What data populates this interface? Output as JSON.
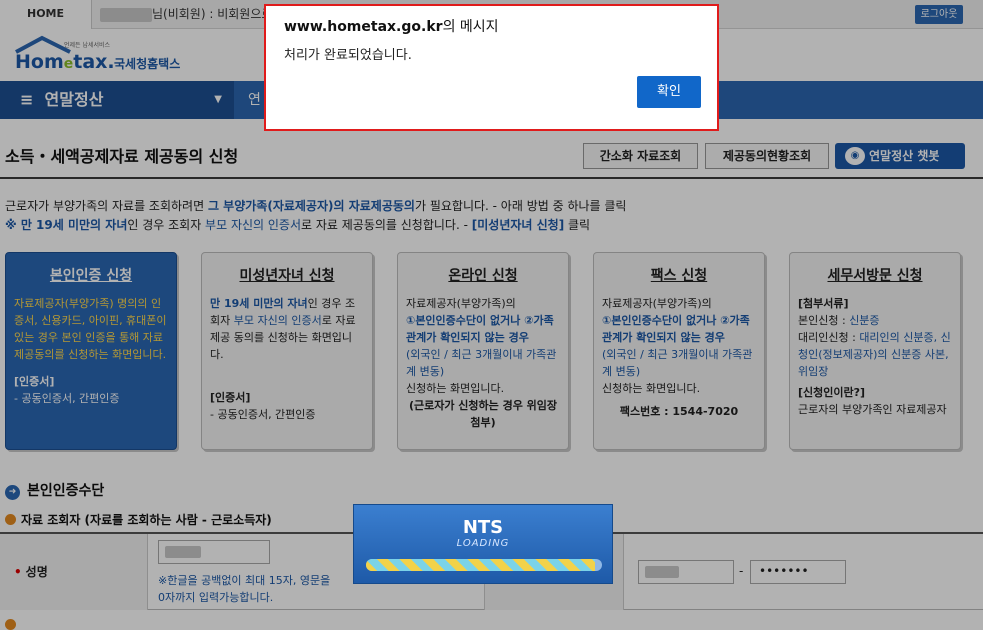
{
  "topbar": {
    "home": "HOME",
    "user_suffix": "님(비회원) : 비회원으로",
    "logout": "로그아웃"
  },
  "logo": {
    "brand": "Hometax",
    "kr": "국세청홈택스",
    "tagline": "언제든 납세서비스"
  },
  "nav": {
    "menu": "연말정산",
    "crumb": "연"
  },
  "page": {
    "title": "소득・세액공제자료 제공동의 신청",
    "btn_simple": "간소화 자료조회",
    "btn_status": "제공동의현황조회",
    "btn_chatbot": "연말정산 챗봇"
  },
  "intro": {
    "l1a": "근로자가 부양가족의 자료를 조회하려면 ",
    "l1b": "그 부양가족(자료제공자)의 자료제공동의",
    "l1c": "가 필요합니다. - 아래 방법 중 하나를 클릭",
    "l2a": "※ 만 19세 미만의 자녀",
    "l2b": "인 경우 조회자 ",
    "l2c": "부모 자신의 인증서",
    "l2d": "로 자료 제공동의를 신청합니다. - ",
    "l2e": "[미성년자녀 신청]",
    "l2f": " 클릭"
  },
  "cards": [
    {
      "title": "본인인증 신청",
      "desc": "자료제공자(부양가족) 명의의 인증서, 신용카드, 아이핀,  휴대폰이 있는 경우 본인 인증을 통해 자료제공동의를 신청하는 화면입니다.",
      "label": "[인증서]",
      "note": "- 공동인증서, 간편인증"
    },
    {
      "title": "미성년자녀 신청",
      "b1": "만 19세 미만의 자녀",
      "t1": "인 경우 조회자 ",
      "b2": "부모 자신의 인증서",
      "t2": "로 자료 제공 동의를 신청하는 화면입니다.",
      "label": "[인증서]",
      "note": "- 공동인증서, 간편인증"
    },
    {
      "title": "온라인 신청",
      "t1": "자료제공자(부양가족)의",
      "b1": "①본인인증수단이 없거나 ②가족관계가 확인되지 않는 경우",
      "t2": "(외국인 / 최근 3개월이내 가족관계 변동)",
      "t3": "신청하는 화면입니다.",
      "c": "(근로자가 신청하는 경우 위임장 첨부)"
    },
    {
      "title": "팩스 신청",
      "t1": "자료제공자(부양가족)의",
      "b1": "①본인인증수단이 없거나 ②가족관계가 확인되지 않는 경우",
      "t2": "(외국인 / 최근 3개월이내 가족관계 변동)",
      "t3": "신청하는 화면입니다.",
      "c": "팩스번호 : 1544-7020"
    },
    {
      "title": "세무서방문 신청",
      "label1": "[첨부서류]",
      "t1": "본인신청 : ",
      "b1": "신분증",
      "t2": "대리인신청 : ",
      "b2": "대리인의 신분증, 신청인(정보제공자)의 신분증 사본, 위임장",
      "label2": "[신청인이란?]",
      "t3": "근로자의 부양가족인 자료제공자"
    }
  ],
  "sections": {
    "auth": "본인인증수단",
    "viewer": "자료 조회자 (자료를 조회하는 사람 - 근로소득자)",
    "name_label": "성명",
    "name_note": "※한글을 공백없이 최대 15자, 영문을",
    "name_note2": "0자까지 입력가능합니다.",
    "pw_mask": "•••••••",
    "dash": "-"
  },
  "loading": {
    "title": "NTS",
    "sub": "LOADING",
    "progress": 0.97
  },
  "dialog": {
    "site": "www.hometax.go.kr",
    "suffix": "의 메시지",
    "message": "처리가 완료되었습니다.",
    "ok": "확인"
  }
}
